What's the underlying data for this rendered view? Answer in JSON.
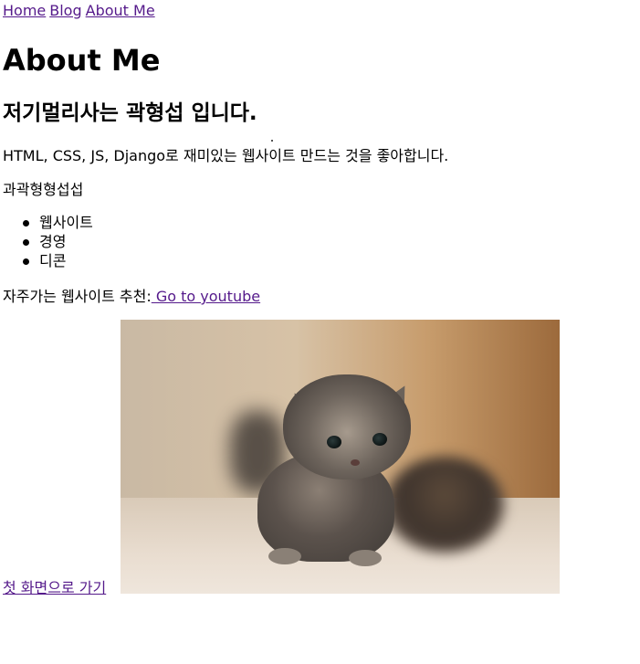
{
  "nav": {
    "home": "Home",
    "blog": "Blog",
    "about": "About Me"
  },
  "heading": "About Me",
  "subheading": "저기멀리사는 곽형섭 입니다.",
  "intro": "HTML, CSS, JS, Django로 재미있는 웹사이트 만드는 것을 좋아합니다.",
  "misc_text": "과곽형형섭섭",
  "interests": [
    "웹사이트",
    "경영",
    "디콘"
  ],
  "recommend": {
    "label": "자주가는 웹사이트 추천:",
    "link": " Go to youtube"
  },
  "back_link": "첫 화면으로 가기",
  "image": {
    "subject": "kitten photo"
  },
  "colors": {
    "visited_link": "#551a8b",
    "link": "#0000ee",
    "text": "#000000",
    "background": "#ffffff"
  }
}
